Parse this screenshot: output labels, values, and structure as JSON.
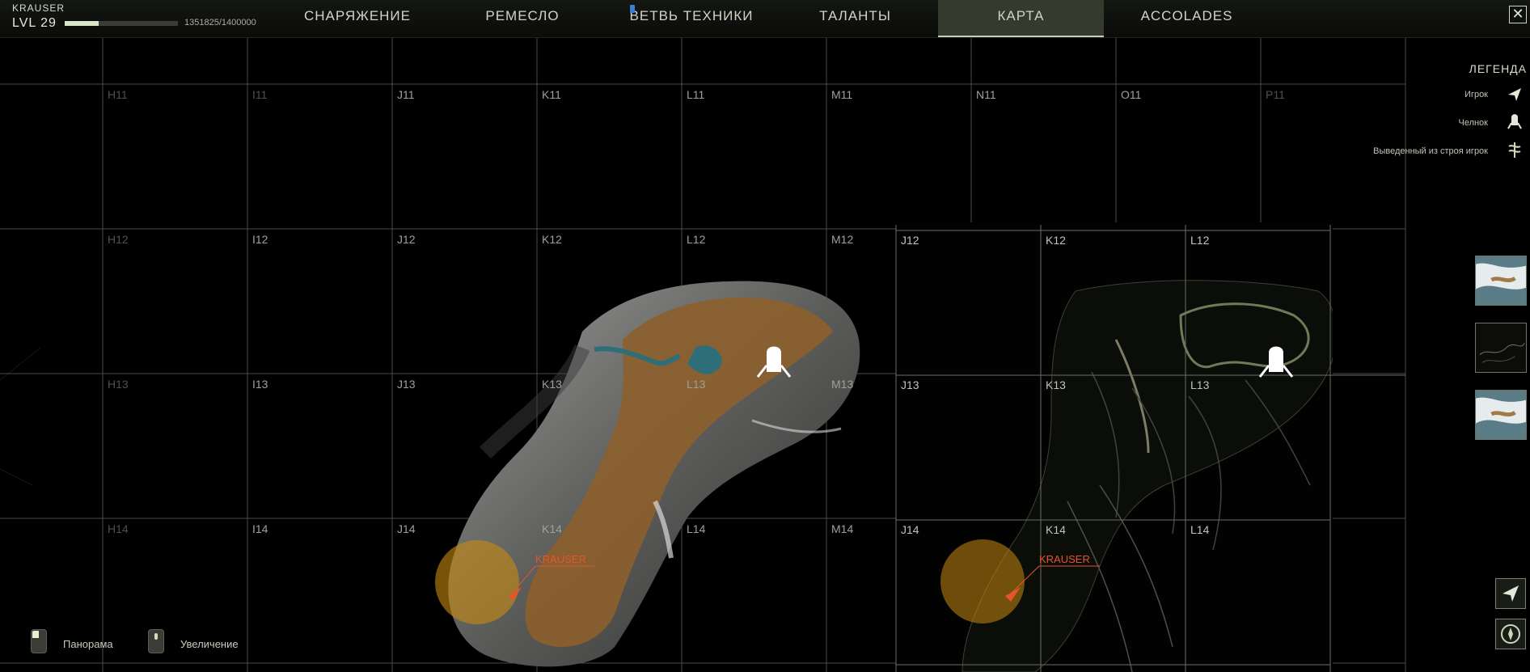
{
  "player": {
    "name": "KRAUSER",
    "level": "LVL 29",
    "xp_text": "1351825/1400000",
    "xp_fraction": 0.3
  },
  "tabs": [
    {
      "label": "СНАРЯЖЕНИЕ"
    },
    {
      "label": "РЕМЕСЛО"
    },
    {
      "label": "ВЕТВЬ ТЕХНИКИ"
    },
    {
      "label": "ТАЛАНТЫ"
    },
    {
      "label": "КАРТА",
      "active": true
    },
    {
      "label": "ACCOLADES"
    }
  ],
  "close": {
    "label": "✕"
  },
  "map": {
    "player_marker_label": "KRAUSER",
    "grid_left_rows": [
      {
        "cells": [
          "H11",
          "I11",
          "J11",
          "K11",
          "L11",
          "M11",
          "N11",
          "O11",
          "P11"
        ]
      },
      {
        "cells": [
          "H12",
          "I12",
          "J12",
          "K12",
          "L12",
          "M12"
        ]
      },
      {
        "cells": [
          "H13",
          "I13",
          "J13",
          "K13",
          "L13",
          "M13"
        ]
      },
      {
        "cells": [
          "H14",
          "I14",
          "J14",
          "K14",
          "L14",
          "M14"
        ]
      }
    ],
    "grid_right_rows": [
      {
        "cells": [
          "J12",
          "K12",
          "L12"
        ]
      },
      {
        "cells": [
          "J13",
          "K13",
          "L13"
        ]
      },
      {
        "cells": [
          "J14",
          "K14",
          "L14"
        ]
      }
    ]
  },
  "legend": {
    "title": "ЛЕГЕНДА",
    "items": [
      {
        "label": "Игрок",
        "icon": "player-arrow-icon"
      },
      {
        "label": "Челнок",
        "icon": "shuttle-icon"
      },
      {
        "label": "Выведенный из строя игрок",
        "icon": "downed-player-icon"
      }
    ]
  },
  "controls": {
    "pan_label": "Панорама",
    "zoom_label": "Увеличение"
  },
  "colors": {
    "accent": "#c6cfae",
    "player_marker": "#e5552b",
    "zone": "#c88a10",
    "terrain_orange": "#9a6a2e",
    "terrain_water": "#2d6e78"
  }
}
